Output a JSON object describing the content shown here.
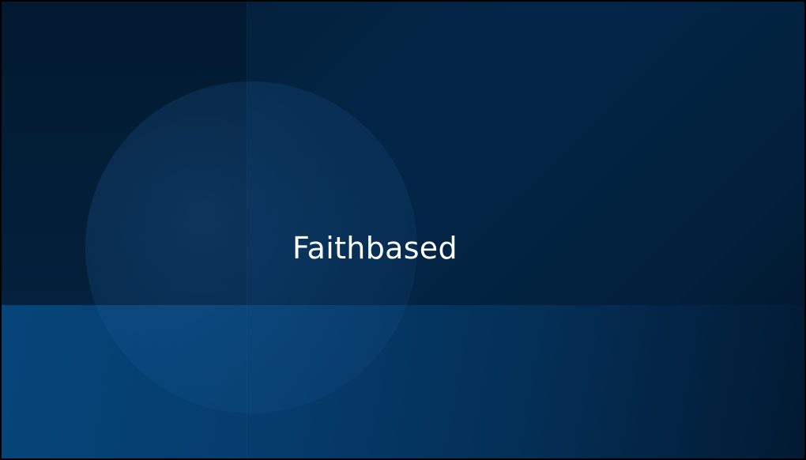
{
  "slide": {
    "title": "Faithbased"
  },
  "colors": {
    "background_dark": "#021a31",
    "background_mid": "#032647",
    "bottom_band": "#06457a",
    "title_text": "#ffffff"
  }
}
